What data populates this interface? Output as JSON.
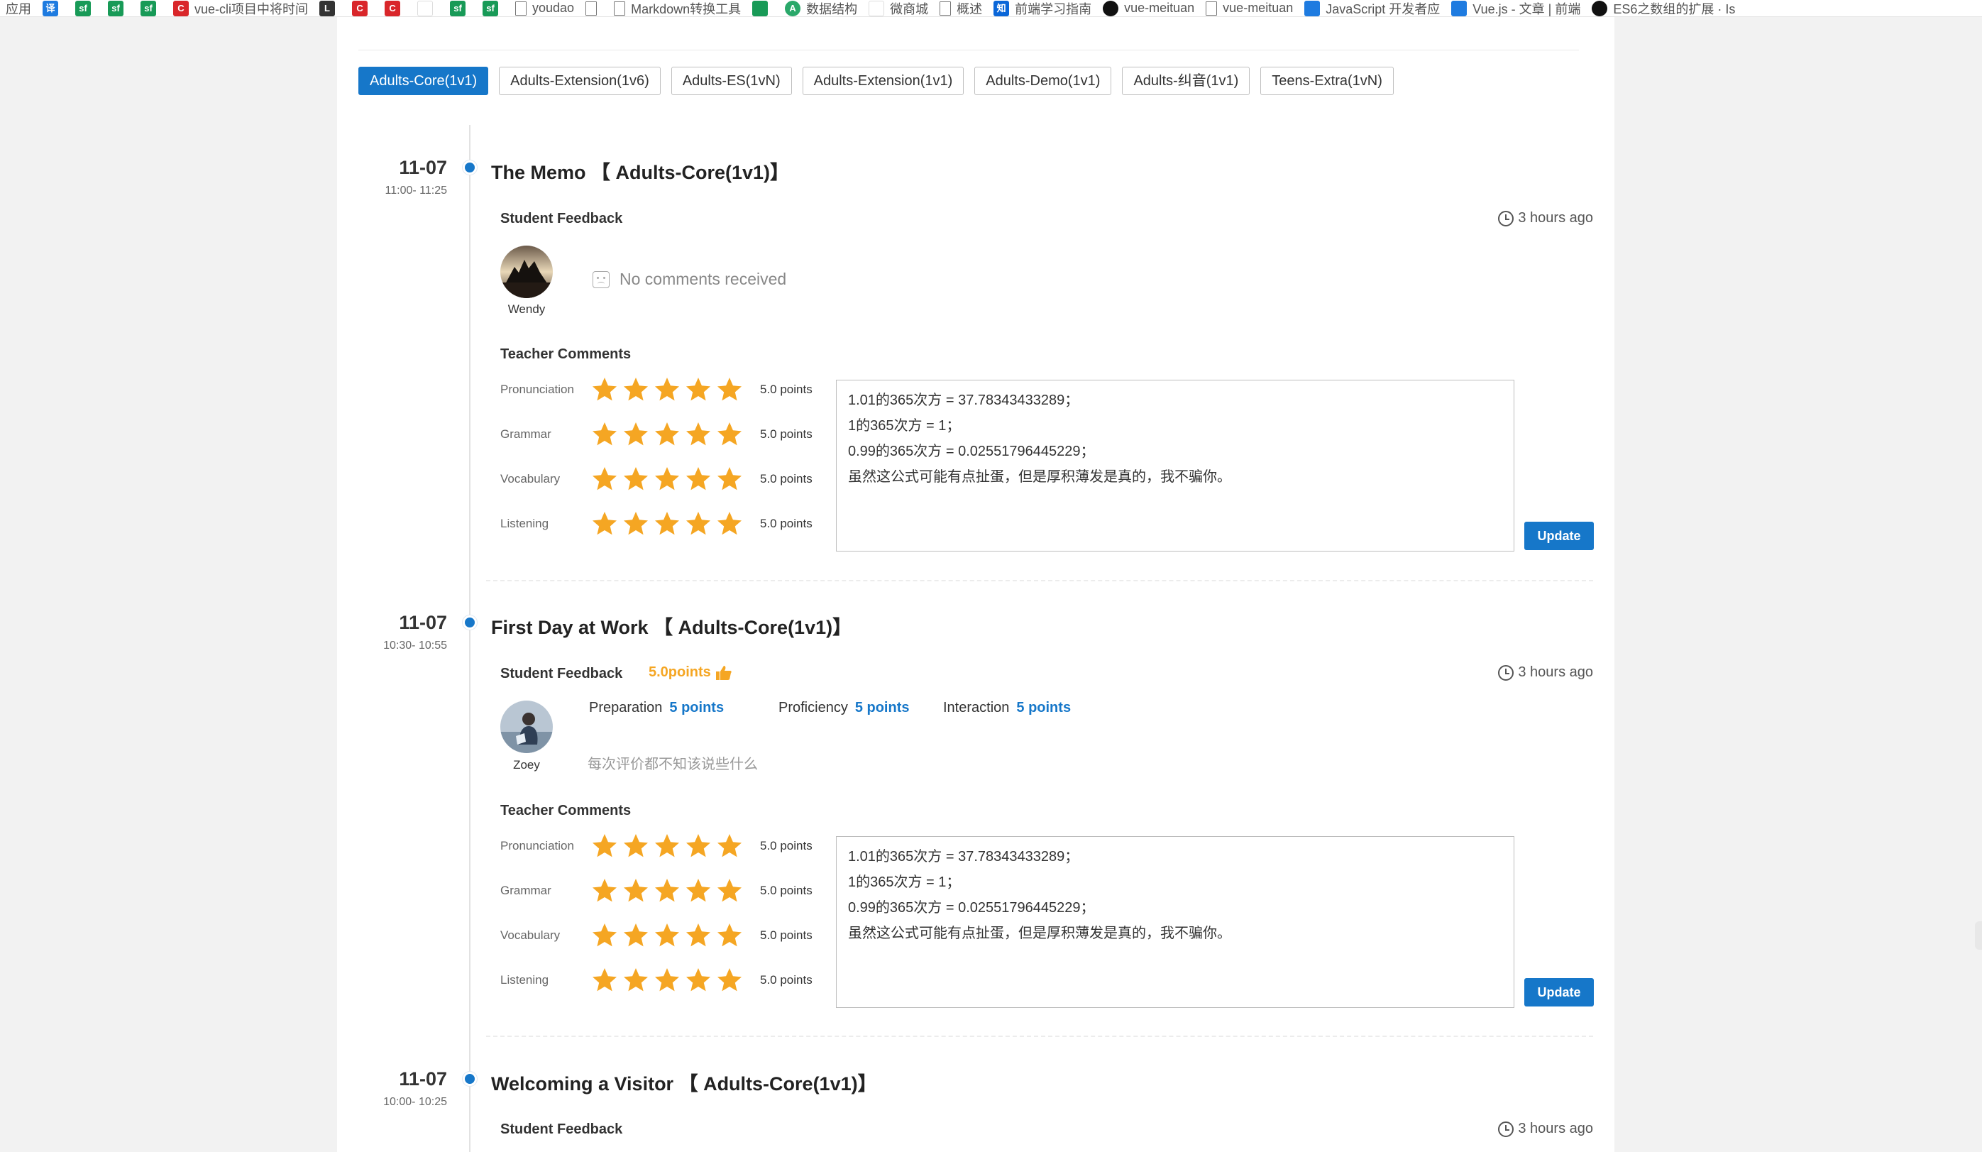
{
  "bookmarks": [
    {
      "icon": "apps-icon",
      "badge": "",
      "label": "应用",
      "color": ""
    },
    {
      "icon": "translate-icon",
      "badge": "译",
      "label": "",
      "color": "blue"
    },
    {
      "icon": "sf-icon",
      "badge": "sf",
      "label": "",
      "color": "green"
    },
    {
      "icon": "sf-icon",
      "badge": "sf",
      "label": "",
      "color": "green"
    },
    {
      "icon": "sf-icon",
      "badge": "sf",
      "label": "",
      "color": "green"
    },
    {
      "icon": "csdn-icon",
      "badge": "C",
      "label": "vue-cli项目中将时间",
      "color": "red"
    },
    {
      "icon": "lib-icon",
      "badge": "L",
      "label": "",
      "color": "dark"
    },
    {
      "icon": "csdn-icon",
      "badge": "C",
      "label": "",
      "color": "red"
    },
    {
      "icon": "csdn-icon",
      "badge": "C",
      "label": "",
      "color": "red"
    },
    {
      "icon": "leaf-icon",
      "badge": "",
      "label": "",
      "color": "light"
    },
    {
      "icon": "sf-icon",
      "badge": "sf",
      "label": "",
      "color": "green"
    },
    {
      "icon": "sf-icon",
      "badge": "sf",
      "label": "",
      "color": "green"
    },
    {
      "icon": "doc-icon",
      "badge": "",
      "label": "youdao",
      "color": "doc"
    },
    {
      "icon": "doc-icon",
      "badge": "",
      "label": "",
      "color": "doc"
    },
    {
      "icon": "doc-icon",
      "badge": "",
      "label": "Markdown转换工具",
      "color": "doc"
    },
    {
      "icon": "cloud-icon",
      "badge": "",
      "label": "",
      "color": "green"
    },
    {
      "icon": "algo-icon",
      "badge": "A",
      "label": "数据结构",
      "color": "circle-green"
    },
    {
      "icon": "shop-icon",
      "badge": "",
      "label": "微商城",
      "color": "light"
    },
    {
      "icon": "doc-icon",
      "badge": "",
      "label": "概述",
      "color": "doc"
    },
    {
      "icon": "zhihu-icon",
      "badge": "知",
      "label": "前端学习指南",
      "color": "zhi"
    },
    {
      "icon": "github-icon",
      "badge": "",
      "label": "vue-meituan",
      "color": "gh"
    },
    {
      "icon": "doc-icon",
      "badge": "",
      "label": "vue-meituan",
      "color": "doc"
    },
    {
      "icon": "juejin-icon",
      "badge": "",
      "label": "JavaScript 开发者应",
      "color": "blue"
    },
    {
      "icon": "vue-icon",
      "badge": "",
      "label": "Vue.js - 文章 | 前端",
      "color": "blue"
    },
    {
      "icon": "github-icon",
      "badge": "",
      "label": "ES6之数组的扩展 · Is",
      "color": "gh"
    }
  ],
  "tabs": [
    {
      "label": "Adults-Core(1v1)",
      "active": true
    },
    {
      "label": "Adults-Extension(1v6)",
      "active": false
    },
    {
      "label": "Adults-ES(1vN)",
      "active": false
    },
    {
      "label": "Adults-Extension(1v1)",
      "active": false
    },
    {
      "label": "Adults-Demo(1v1)",
      "active": false
    },
    {
      "label": "Adults-纠音(1v1)",
      "active": false
    },
    {
      "label": "Teens-Extra(1vN)",
      "active": false
    }
  ],
  "labels": {
    "student_feedback": "Student Feedback",
    "teacher_comments": "Teacher Comments",
    "update": "Update",
    "no_comments": "No comments received"
  },
  "entries": [
    {
      "date": "11-07",
      "time": "11:00- 11:25",
      "title": "The Memo  【 Adults-Core(1v1)】",
      "ago": "3 hours ago",
      "student": "Wendy",
      "ratings": [
        {
          "label": "Pronunciation",
          "stars": 5,
          "points": "5.0 points"
        },
        {
          "label": "Grammar",
          "stars": 5,
          "points": "5.0 points"
        },
        {
          "label": "Vocabulary",
          "stars": 5,
          "points": "5.0 points"
        },
        {
          "label": "Listening",
          "stars": 5,
          "points": "5.0 points"
        }
      ],
      "comment_lines": [
        "1.01的365次方 = 37.78343433289；",
        "1的365次方 = 1；",
        "0.99的365次方 = 0.02551796445229；",
        "虽然这公式可能有点扯蛋，但是厚积薄发是真的，我不骗你。"
      ]
    },
    {
      "date": "11-07",
      "time": "10:30- 10:55",
      "title": "First Day at Work  【 Adults-Core(1v1)】",
      "ago": "3 hours ago",
      "student": "Zoey",
      "score": "5.0points",
      "metrics": [
        {
          "label": "Preparation",
          "value": "5 points"
        },
        {
          "label": "Proficiency",
          "value": "5 points"
        },
        {
          "label": "Interaction",
          "value": "5 points"
        }
      ],
      "feedback_text": "每次评价都不知该说些什么",
      "ratings": [
        {
          "label": "Pronunciation",
          "stars": 5,
          "points": "5.0 points"
        },
        {
          "label": "Grammar",
          "stars": 5,
          "points": "5.0 points"
        },
        {
          "label": "Vocabulary",
          "stars": 5,
          "points": "5.0 points"
        },
        {
          "label": "Listening",
          "stars": 5,
          "points": "5.0 points"
        }
      ],
      "comment_lines": [
        "1.01的365次方 = 37.78343433289；",
        "1的365次方 = 1；",
        "0.99的365次方 = 0.02551796445229；",
        "虽然这公式可能有点扯蛋，但是厚积薄发是真的，我不骗你。"
      ]
    },
    {
      "date": "11-07",
      "time": "10:00- 10:25",
      "title": "Welcoming a Visitor  【 Adults-Core(1v1)】",
      "ago": "3 hours ago"
    }
  ],
  "colors": {
    "accent": "#1677c9",
    "star": "#f5a623",
    "score": "#f5a623"
  }
}
